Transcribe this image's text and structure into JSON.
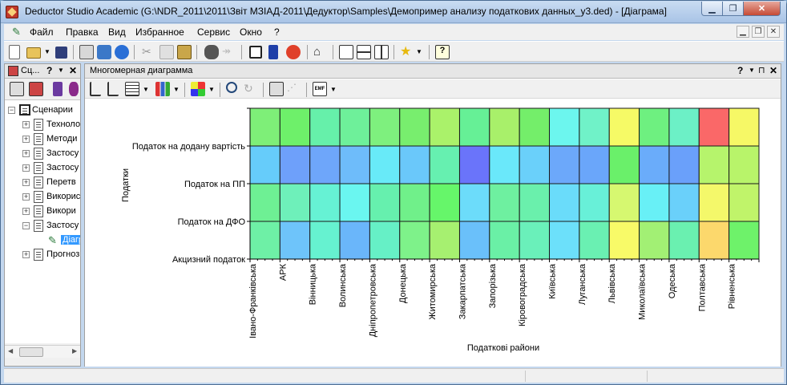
{
  "window": {
    "title": "Deductor Studio Academic (G:\\NDR_2011\\2011\\Звіт МЗІАД-2011\\Дедуктор\\Samples\\Демопример анализу податкових данных_у3.ded) - [Діаграма]",
    "min_label": "▁",
    "max_label": "❐",
    "close_label": "✕"
  },
  "menu": {
    "items": [
      "Файл",
      "Правка",
      "Вид",
      "Избранное",
      "Сервис",
      "Окно",
      "?"
    ],
    "mdi_min": "▁",
    "mdi_restore": "❐",
    "mdi_close": "✕"
  },
  "left_panel": {
    "header_label": "Сц...",
    "help_label": "?",
    "drop_label": "▼",
    "close_label": "✕",
    "tree": [
      {
        "label": "Сценарии",
        "level": 0,
        "expander": "−",
        "icon": "scenario-icon"
      },
      {
        "label": "Техноло",
        "level": 1,
        "expander": "+",
        "icon": "document-icon"
      },
      {
        "label": "Методи",
        "level": 1,
        "expander": "+",
        "icon": "document-icon"
      },
      {
        "label": "Застосу",
        "level": 1,
        "expander": "+",
        "icon": "document-icon"
      },
      {
        "label": "Застосу",
        "level": 1,
        "expander": "+",
        "icon": "document-icon"
      },
      {
        "label": "Перетв",
        "level": 1,
        "expander": "+",
        "icon": "document-icon"
      },
      {
        "label": "Викорис",
        "level": 1,
        "expander": "+",
        "icon": "document-icon"
      },
      {
        "label": "Викори",
        "level": 1,
        "expander": "+",
        "icon": "document-icon"
      },
      {
        "label": "Застосу",
        "level": 1,
        "expander": "−",
        "icon": "document-icon"
      },
      {
        "label": "Діагр",
        "level": 2,
        "expander": "",
        "icon": "chart-node-icon",
        "selected": true
      },
      {
        "label": "Прогноз",
        "level": 1,
        "expander": "+",
        "icon": "document-icon"
      }
    ]
  },
  "right_panel": {
    "title": "Многомерная диаграмма",
    "help_label": "?",
    "drop_label": "▼",
    "pin_label": "⊓",
    "close_label": "✕"
  },
  "chart_data": {
    "type": "heatmap",
    "ylabel": "Податки",
    "xlabel": "Податкові райони",
    "rows": [
      "Податок на додану вартість",
      "Податок на ПП",
      "Податок на ДФО",
      "Акцизний податок"
    ],
    "columns": [
      "Івано-Франківська",
      "АРК",
      "Вінницька",
      "Волинська",
      "Дніпропетровська",
      "Донецька",
      "Житомирська",
      "Закарпатська",
      "Запорізька",
      "Кіровоградська",
      "Київська",
      "Луганська",
      "Львівська",
      "Миколаївська",
      "Одеська",
      "Полтавська",
      "Рівненська"
    ],
    "colors": [
      [
        "#7eef78",
        "#6ef06a",
        "#66f0aa",
        "#6ef09a",
        "#7ef07e",
        "#78ee6e",
        "#aaf26a",
        "#66f096",
        "#a8f06a",
        "#74ee6a",
        "#6cf6ee",
        "#70f2c8",
        "#f6fa66",
        "#6ef080",
        "#6cf0c6",
        "#fa6868",
        "#f6f866"
      ],
      [
        "#66ccfa",
        "#6ea0fa",
        "#6ea6fa",
        "#6ebcfa",
        "#68eaf8",
        "#6ac8fa",
        "#66f0b0",
        "#6a74fa",
        "#6ae8fa",
        "#6ad0fa",
        "#6ca8fa",
        "#6aa6fa",
        "#6af06a",
        "#6aacfa",
        "#6aa0fa",
        "#b6f46c",
        "#b8f46a"
      ],
      [
        "#6ef094",
        "#6ef0ba",
        "#66f2d4",
        "#6af6f0",
        "#66f0ae",
        "#70f08a",
        "#66f66a",
        "#6cdcfa",
        "#6ef0a0",
        "#6af0ac",
        "#6adcfa",
        "#68f0d8",
        "#d6f870",
        "#68f0f6",
        "#6ad0fa",
        "#f4f86a",
        "#c0f46a"
      ],
      [
        "#6ef0a6",
        "#6ec4fa",
        "#66f2d0",
        "#6ab6fa",
        "#66f0c6",
        "#7ef28a",
        "#a6f070",
        "#6ac0fa",
        "#6af0a6",
        "#6af0ba",
        "#6ce0fa",
        "#6af0b2",
        "#f8fa68",
        "#a2f074",
        "#6af0b0",
        "#fcd86c",
        "#6ef26a"
      ]
    ]
  }
}
